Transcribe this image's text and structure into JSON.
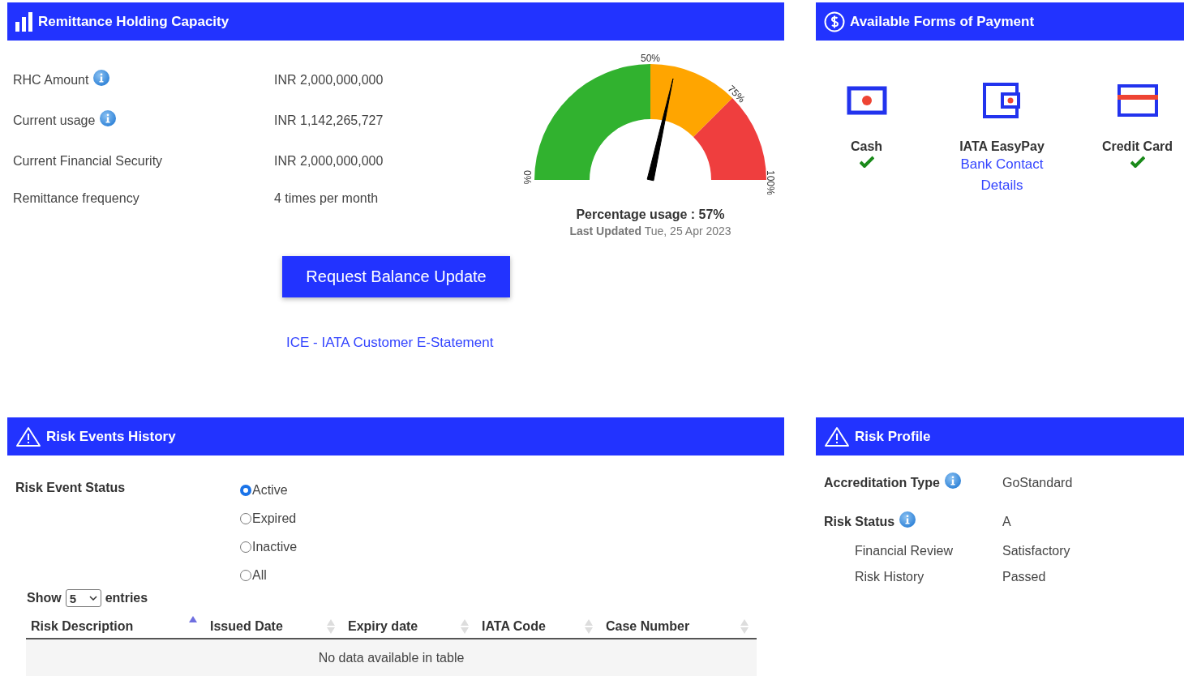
{
  "rhc": {
    "title": "Remittance Holding Capacity",
    "rows": [
      {
        "label": "RHC Amount",
        "info": true,
        "value": "INR 2,000,000,000"
      },
      {
        "label": "Current usage",
        "info": true,
        "value": "INR 1,142,265,727"
      },
      {
        "label": "Current Financial Security",
        "info": false,
        "value": "INR 2,000,000,000"
      },
      {
        "label": "Remittance frequency",
        "info": false,
        "value": "4 times per month"
      }
    ],
    "gauge": {
      "ticks": [
        "0%",
        "50%",
        "75%",
        "100%"
      ],
      "caption": "Percentage usage : 57%",
      "updated": "**Last Updated** Tue, 25 Apr 2023"
    },
    "button": "Request Balance Update",
    "link": "ICE - IATA Customer E-Statement"
  },
  "payment": {
    "title": "Available Forms of Payment",
    "methods": [
      {
        "kind": "cash",
        "name": "Cash",
        "available": true
      },
      {
        "kind": "wallet",
        "name": "IATA EasyPay",
        "available": false,
        "link": "Bank Contact Details"
      },
      {
        "kind": "card",
        "name": "Credit Card",
        "available": true
      }
    ]
  },
  "risk_events": {
    "title": "Risk Events History",
    "status_label": "Risk Event Status",
    "options": [
      {
        "label": "Active",
        "selected": true
      },
      {
        "label": "Expired",
        "selected": false
      },
      {
        "label": "Inactive",
        "selected": false
      },
      {
        "label": "All",
        "selected": false
      }
    ],
    "show": {
      "before": "Show",
      "value": "5",
      "after": "entries"
    },
    "table": {
      "columns": [
        {
          "label": "Risk Description",
          "sorted": true
        },
        {
          "label": "Issued Date",
          "sorted": false
        },
        {
          "label": "Expiry date",
          "sorted": false
        },
        {
          "label": "IATA Code",
          "sorted": false
        },
        {
          "label": "Case Number",
          "sorted": false
        }
      ],
      "empty": "No data available in table"
    }
  },
  "risk_profile": {
    "title": "Risk Profile",
    "rows": [
      {
        "kind": "main",
        "label": "Accreditation Type",
        "info": true,
        "value": "GoStandard"
      },
      {
        "kind": "main",
        "label": "Risk Status",
        "info": true,
        "value": "A"
      },
      {
        "kind": "sub",
        "label": "Financial Review",
        "info": false,
        "value": "Satisfactory"
      },
      {
        "kind": "sub",
        "label": "Risk History",
        "info": false,
        "value": "Passed"
      }
    ]
  }
}
